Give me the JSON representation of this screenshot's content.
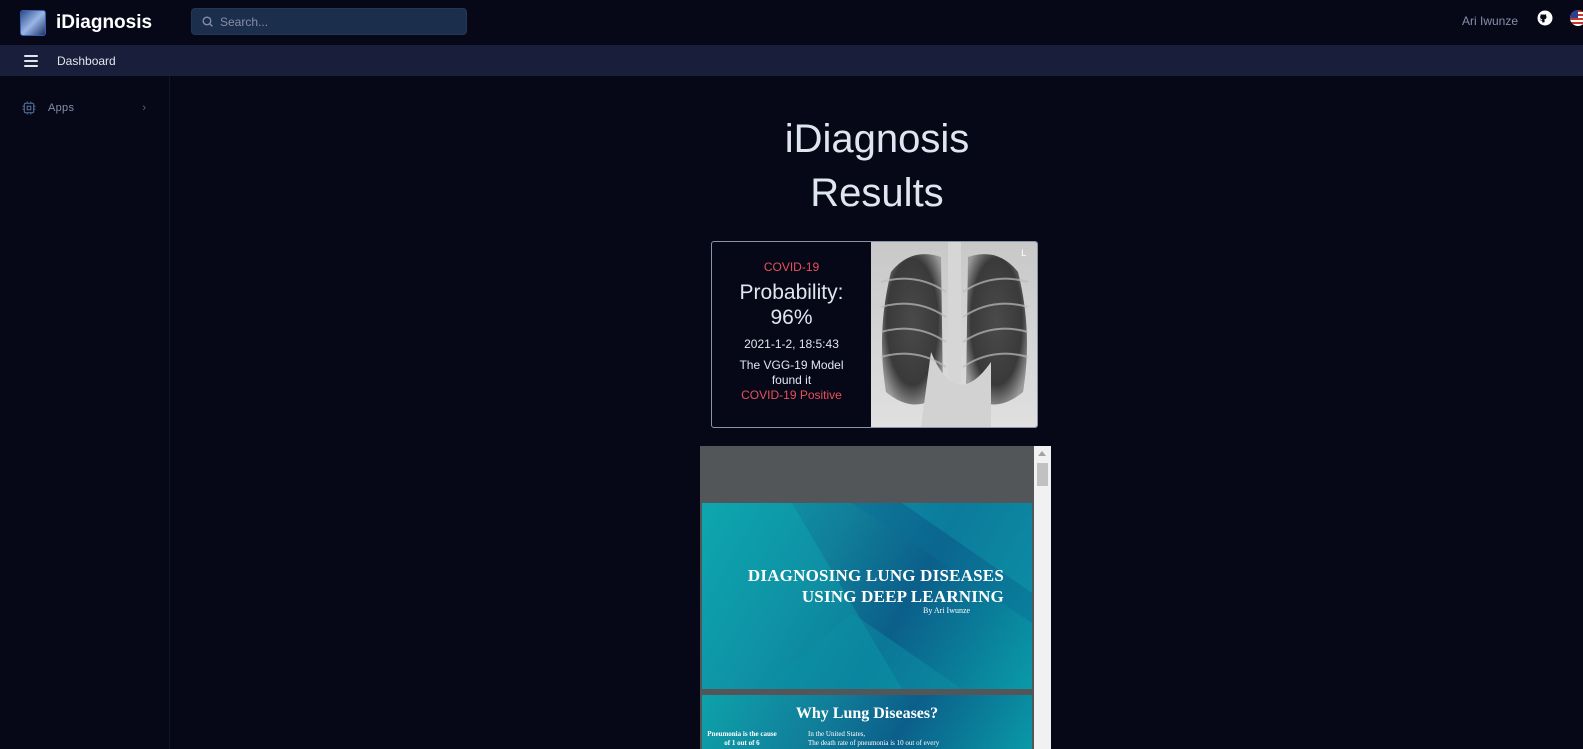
{
  "app": {
    "brand": "iDiagnosis",
    "search_placeholder": "Search...",
    "user_name": "Ari Iwunze"
  },
  "subbar": {
    "breadcrumb": "Dashboard"
  },
  "sidebar": {
    "items": [
      {
        "label": "Apps",
        "icon": "cpu-icon"
      }
    ]
  },
  "main": {
    "title_line1": "iDiagnosis",
    "title_line2": "Results",
    "result": {
      "diagnosis": "COVID-19",
      "probability_label": "Probability:",
      "probability_value": "96%",
      "timestamp": "2021-1-2, 18:5:43",
      "model_text": "The VGG-19 Model found it",
      "result_text": "COVID-19 Positive"
    },
    "document": {
      "slide1_title_line1": "DIAGNOSING LUNG DISEASES",
      "slide1_title_line2": "USING DEEP LEARNING",
      "slide1_author": "By Ari Iwunze",
      "slide2_title": "Why Lung Diseases?",
      "slide2_left": "Pneumonia is the cause of 1 out of 6",
      "slide2_right_line1": "In the United States,",
      "slide2_right_line2": "The death rate of pneumonia is 10 out of every"
    }
  },
  "colors": {
    "background": "#060818",
    "subbar": "#191e3a",
    "danger": "#e7515a",
    "slide_teal": "#0ea2ab"
  }
}
